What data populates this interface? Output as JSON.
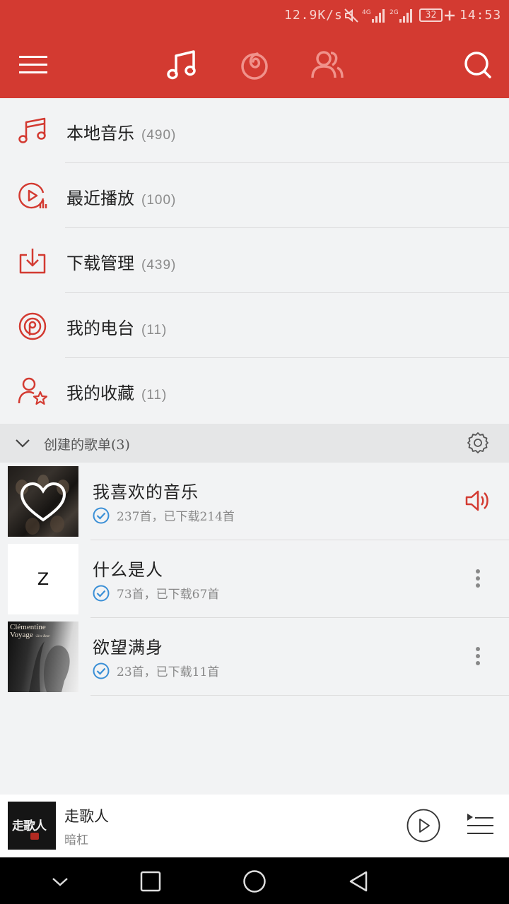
{
  "status_bar": {
    "net_speed": "12.9K/s",
    "signal1_label": "4G",
    "signal2_label": "2G",
    "battery": "32",
    "time": "14:53"
  },
  "toolbar": {
    "icons": [
      "menu-icon",
      "music-note-icon",
      "netease-logo-icon",
      "friends-icon",
      "search-icon"
    ],
    "accent": "#d33a31"
  },
  "menu": [
    {
      "label": "本地音乐",
      "count": "(490)",
      "icon": "music-note-icon"
    },
    {
      "label": "最近播放",
      "count": "(100)",
      "icon": "recent-play-icon"
    },
    {
      "label": "下载管理",
      "count": "(439)",
      "icon": "download-icon"
    },
    {
      "label": "我的电台",
      "count": "(11)",
      "icon": "radio-icon"
    },
    {
      "label": "我的收藏",
      "count": "(11)",
      "icon": "collection-icon"
    }
  ],
  "section": {
    "title": "创建的歌单(3)"
  },
  "playlists": [
    {
      "name": "我喜欢的音乐",
      "sub": "237首，已下载214首",
      "action": "speaker-icon"
    },
    {
      "name": "什么是人",
      "sub": "73首，已下载67首",
      "thumb_text": "Z",
      "action": "more-icon"
    },
    {
      "name": "欲望满身",
      "sub": "23首，已下载11首",
      "thumb_text_1": "Clémentine",
      "thumb_text_2": "Voyage",
      "thumb_text_3": "-Live Best-",
      "action": "more-icon"
    }
  ],
  "player": {
    "title": "走歌人",
    "artist": "暗杠",
    "cover_text": "走歌人"
  }
}
